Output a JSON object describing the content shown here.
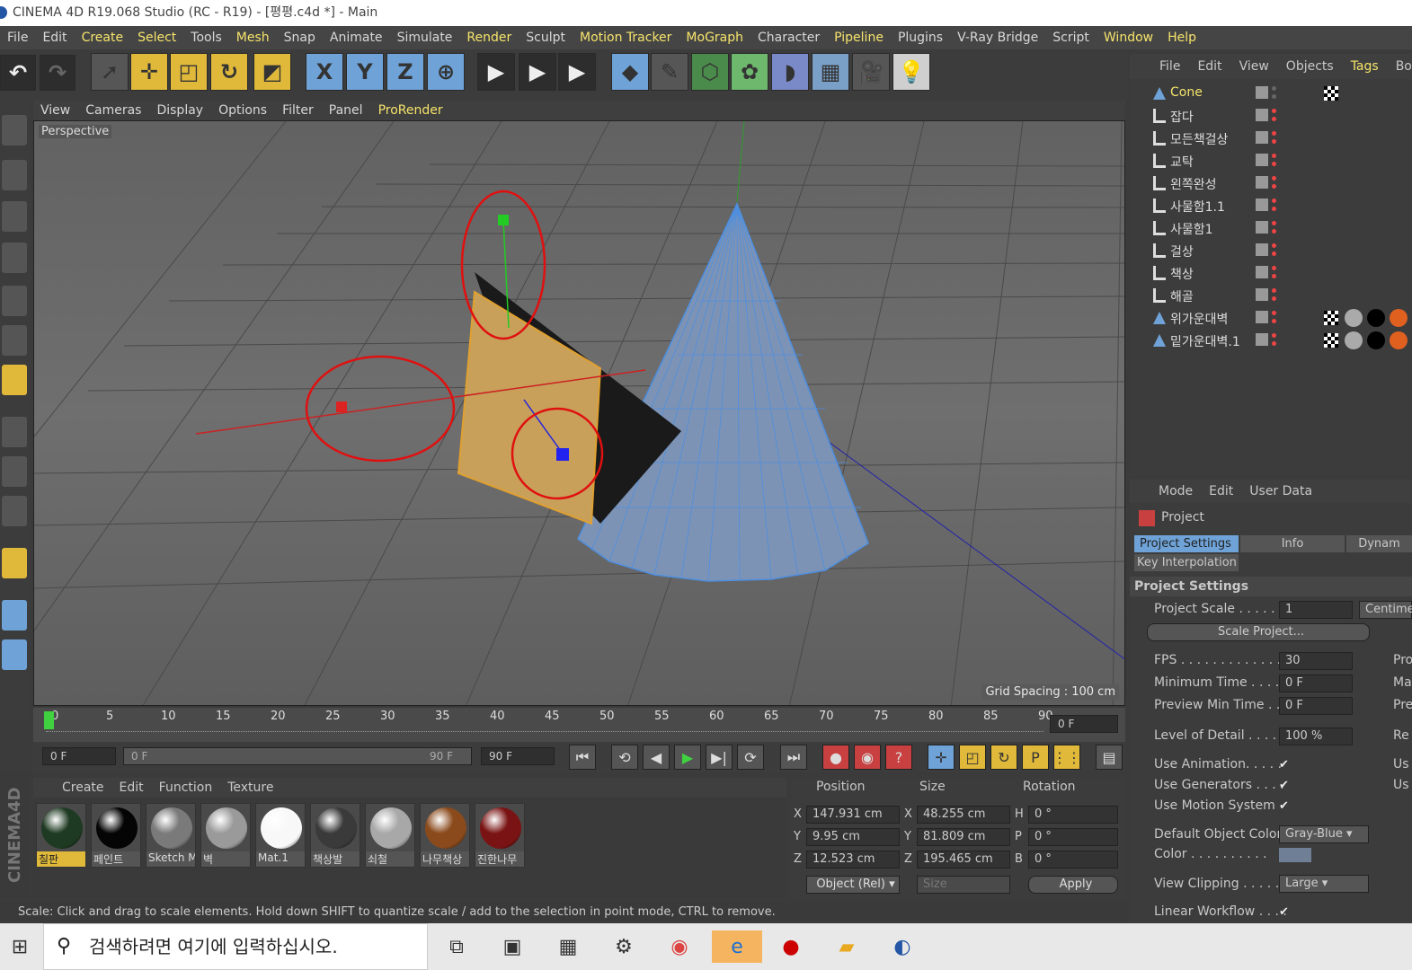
{
  "window": {
    "title": "CINEMA 4D R19.068 Studio (RC - R19) - [평평.c4d *] - Main"
  },
  "menu": [
    "File",
    "Edit",
    "Create",
    "Select",
    "Tools",
    "Mesh",
    "Snap",
    "Animate",
    "Simulate",
    "Render",
    "Sculpt",
    "Motion Tracker",
    "MoGraph",
    "Character",
    "Pipeline",
    "Plugins",
    "V-Ray Bridge",
    "Script",
    "Window",
    "Help"
  ],
  "menu_highlight": [
    "Create",
    "Select",
    "Mesh",
    "Render",
    "Motion Tracker",
    "MoGraph",
    "Pipeline",
    "Window",
    "Help"
  ],
  "toolbar": {
    "x": "X",
    "y": "Y",
    "z": "Z"
  },
  "viewport": {
    "menu": [
      "View",
      "Cameras",
      "Display",
      "Options",
      "Filter",
      "Panel",
      "ProRender"
    ],
    "label": "Perspective",
    "grid_spacing": "Grid Spacing : 100 cm"
  },
  "timeline": {
    "ticks": [
      "0",
      "5",
      "10",
      "15",
      "20",
      "25",
      "30",
      "35",
      "40",
      "45",
      "50",
      "55",
      "60",
      "65",
      "70",
      "75",
      "80",
      "85",
      "90"
    ],
    "current_frame": "0 F",
    "start": "0 F",
    "range_start": "0 F",
    "range_end": "90 F",
    "end": "90 F"
  },
  "materials": {
    "menu": [
      "Create",
      "Edit",
      "Function",
      "Texture"
    ],
    "items": [
      {
        "name": "칠판",
        "color": "#1e3a22",
        "selected": true
      },
      {
        "name": "페인트",
        "color": "#050505"
      },
      {
        "name": "Sketch M",
        "color": "#7a7a7a"
      },
      {
        "name": "벽",
        "color": "#9a9a9a"
      },
      {
        "name": "Mat.1",
        "color": "#f8f8f8"
      },
      {
        "name": "책상발",
        "color": "#3a3a3a"
      },
      {
        "name": "쇠철",
        "color": "#a8a8a8"
      },
      {
        "name": "나무책상",
        "color": "#8a4a1c"
      },
      {
        "name": "진한나무",
        "color": "#7a1414"
      }
    ]
  },
  "coords": {
    "headers": [
      "Position",
      "Size",
      "Rotation"
    ],
    "pos": {
      "x": "147.931 cm",
      "y": "9.95 cm",
      "z": "12.523 cm"
    },
    "size": {
      "x": "48.255 cm",
      "y": "81.809 cm",
      "z": "195.465 cm"
    },
    "rot": {
      "h": "0 °",
      "p": "0 °",
      "b": "0 °"
    },
    "axes": {
      "x": "X",
      "y": "Y",
      "z": "Z",
      "h": "H",
      "p": "P",
      "b": "B"
    },
    "mode": "Object (Rel)",
    "size_mode": "Size",
    "apply": "Apply"
  },
  "status": "Scale: Click and drag to scale elements. Hold down SHIFT to quantize scale / add to the selection in point mode, CTRL to remove.",
  "objects": {
    "menu": [
      "File",
      "Edit",
      "View",
      "Objects",
      "Tags",
      "Bookm"
    ],
    "items": [
      "Cone",
      "잡다",
      "모든책걸상",
      "교탁",
      "왼쪽완성",
      "사물함1.1",
      "사물함1",
      "걸상",
      "책상",
      "해골",
      "위가운대벽",
      "밑가운대벽.1"
    ]
  },
  "attributes": {
    "menu": [
      "Mode",
      "Edit",
      "User Data"
    ],
    "project": "Project",
    "tabs": [
      "Project Settings",
      "Info",
      "Dynam",
      "Key Interpolation"
    ],
    "section": "Project Settings",
    "scale_label": "Project Scale . . . . . .",
    "scale_value": "1",
    "scale_unit": "Centime",
    "scale_btn": "Scale Project...",
    "fps_label": "FPS . . . . . . . . . . . . . . .",
    "fps": "30",
    "min_label": "Minimum Time . . . .",
    "min": "0 F",
    "pmin_label": "Preview Min Time . .",
    "pmin": "0 F",
    "lod_label": "Level of Detail . . . . .",
    "lod": "100 %",
    "anim_label": "Use Animation. . . . .",
    "gen_label": "Use Generators . . . .",
    "motion_label": "Use Motion System",
    "doc_label": "Default Object Color",
    "doc": "Gray-Blue",
    "color_label": "Color . . . . . . . . . .",
    "clip_label": "View Clipping . . . . .",
    "clip": "Large",
    "lw_label": "Linear Workflow . . . .",
    "right_cut": [
      "Pro",
      "Ma",
      "Pre",
      "Re",
      "Us",
      "Us"
    ]
  },
  "taskbar": {
    "search": "검색하려면 여기에 입력하십시오."
  }
}
